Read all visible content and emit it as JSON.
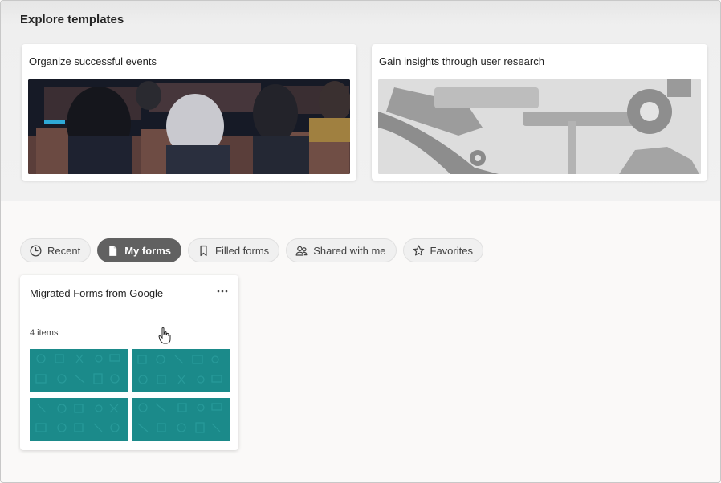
{
  "templates": {
    "title": "Explore templates",
    "cards": [
      {
        "label": "Organize successful events"
      },
      {
        "label": "Gain insights through user research"
      }
    ]
  },
  "filters": [
    {
      "label": "Recent",
      "icon": "clock-icon",
      "active": false
    },
    {
      "label": "My forms",
      "icon": "document-icon",
      "active": true
    },
    {
      "label": "Filled forms",
      "icon": "bookmark-icon",
      "active": false
    },
    {
      "label": "Shared with me",
      "icon": "people-icon",
      "active": false
    },
    {
      "label": "Favorites",
      "icon": "star-icon",
      "active": false
    }
  ],
  "collection": {
    "title": "Migrated Forms from Google",
    "count": "4 items",
    "thumb_color": "#1b8a8a"
  },
  "colors": {
    "active_pill": "#616161",
    "pill_bg": "#f0f0f0",
    "thumb_teal": "#1b8a8a"
  }
}
